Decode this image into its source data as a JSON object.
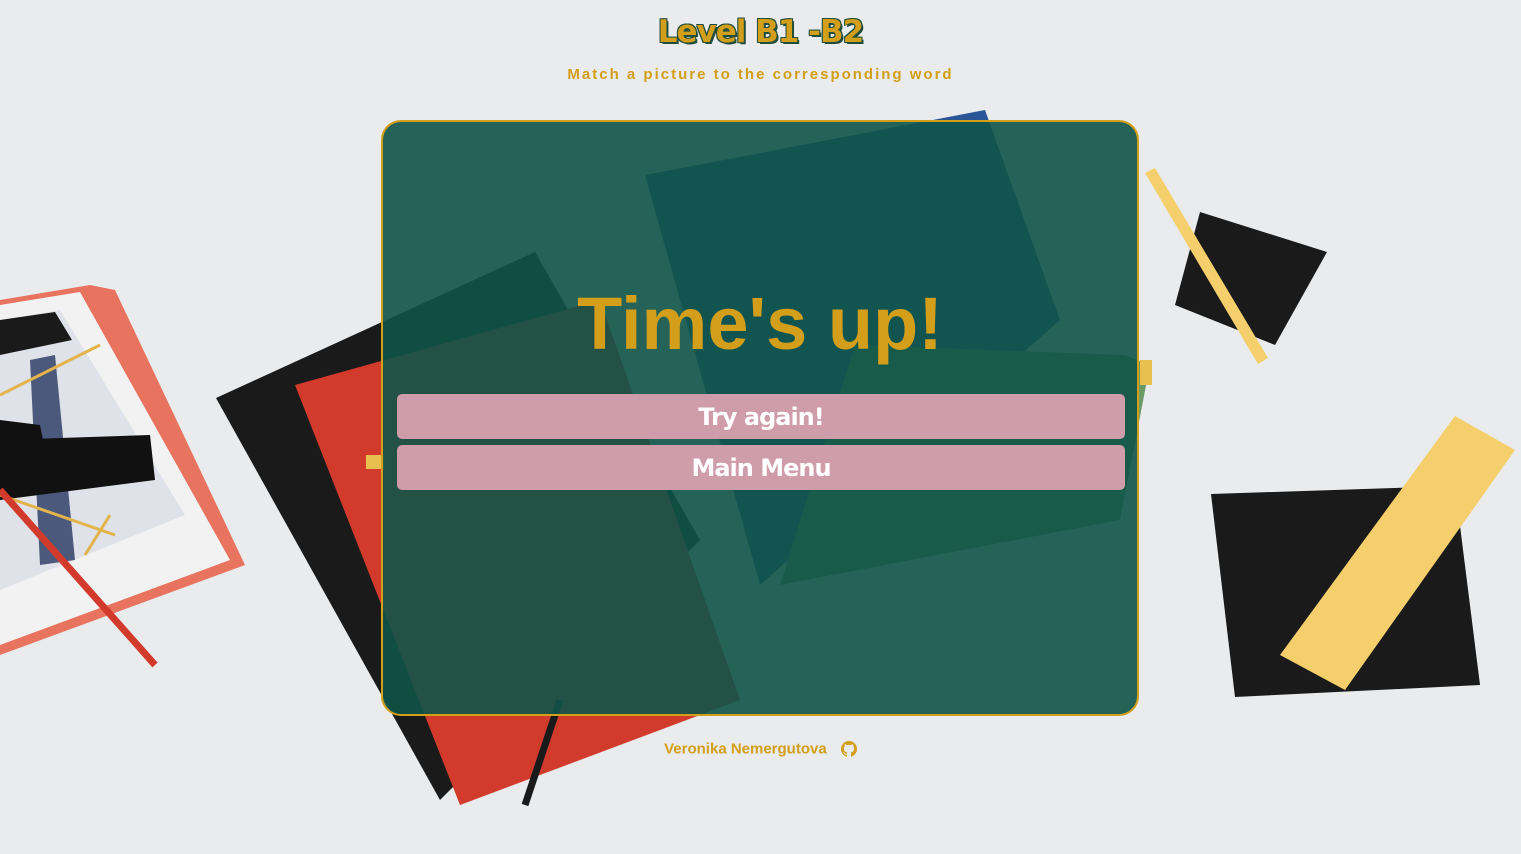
{
  "header": {
    "title": "Level B1 -B2",
    "subtitle": "Match a picture to the corresponding word"
  },
  "game_panel": {
    "result_message": "Time's up!",
    "buttons": {
      "try_again": "Try again!",
      "main_menu": "Main Menu"
    }
  },
  "footer": {
    "author": "Veronika Nemergutova",
    "icon": "github-icon"
  },
  "colors": {
    "accent": "#d39e1a",
    "panel": "#105448",
    "button": "#cf9ca9",
    "title_outline": "#1f4d3c"
  }
}
